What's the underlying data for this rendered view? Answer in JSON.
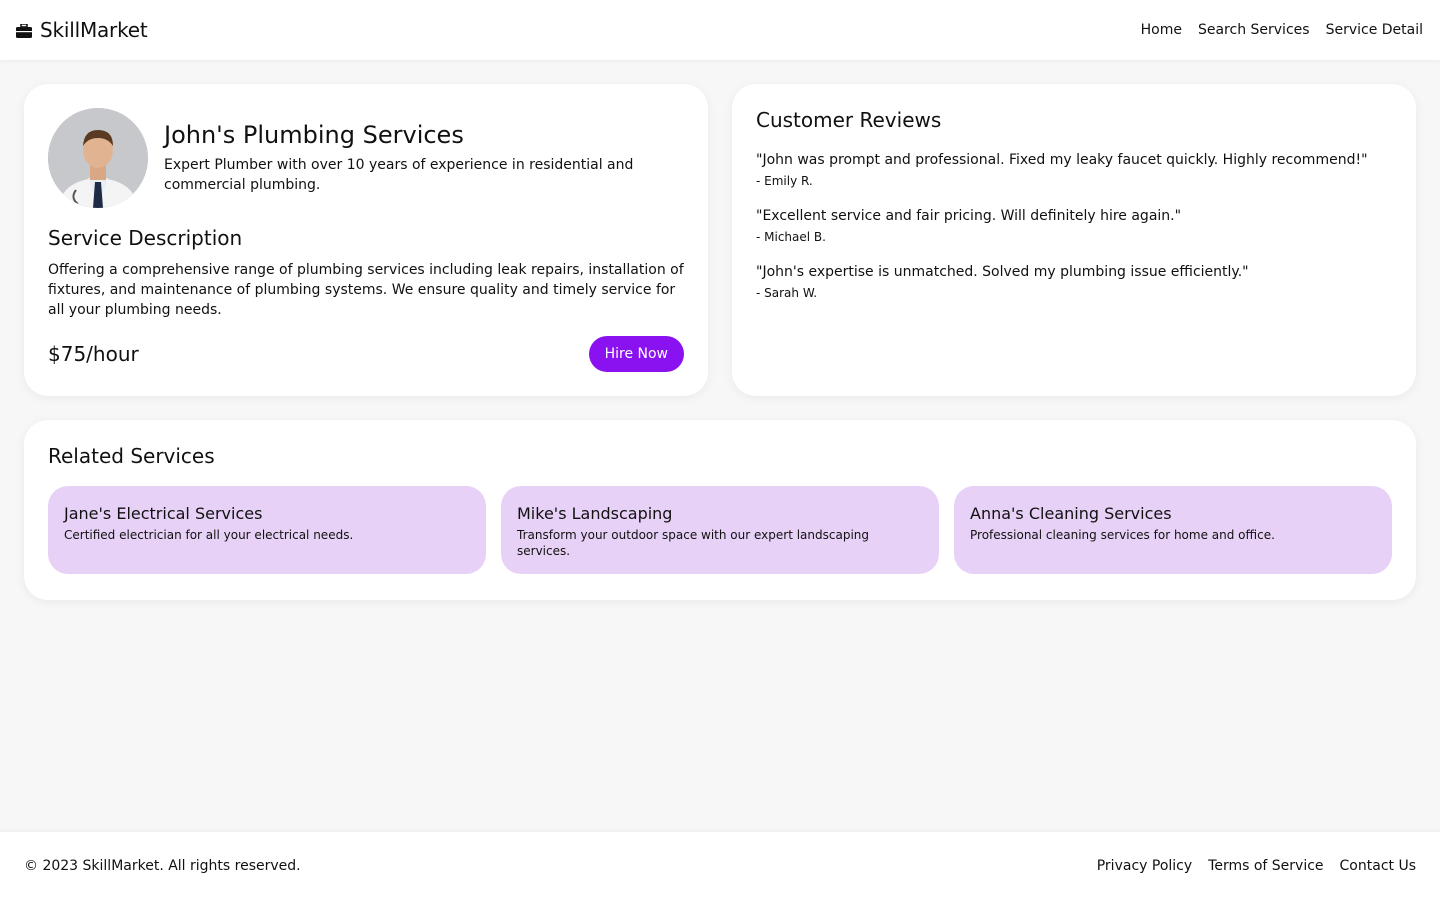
{
  "header": {
    "brand_icon": "briefcase-icon",
    "brand": "SkillMarket",
    "nav": [
      "Home",
      "Search Services",
      "Service Detail"
    ]
  },
  "provider": {
    "avatar_icon": "provider-avatar",
    "name": "John's Plumbing Services",
    "tagline": "Expert Plumber with over 10 years of experience in residential and commercial plumbing.",
    "description_title": "Service Description",
    "description": "Offering a comprehensive range of plumbing services including leak repairs, installation of fixtures, and maintenance of plumbing systems. We ensure quality and timely service for all your plumbing needs.",
    "price": "$75/hour",
    "hire_label": "Hire Now"
  },
  "reviews": {
    "title": "Customer Reviews",
    "items": [
      {
        "text": "\"John was prompt and professional. Fixed my leaky faucet quickly. Highly recommend!\"",
        "author": "- Emily R."
      },
      {
        "text": "\"Excellent service and fair pricing. Will definitely hire again.\"",
        "author": "- Michael B."
      },
      {
        "text": "\"John's expertise is unmatched. Solved my plumbing issue efficiently.\"",
        "author": "- Sarah W."
      }
    ]
  },
  "related": {
    "title": "Related Services",
    "items": [
      {
        "name": "Jane's Electrical Services",
        "desc": "Certified electrician for all your electrical needs."
      },
      {
        "name": "Mike's Landscaping",
        "desc": "Transform your outdoor space with our expert landscaping services."
      },
      {
        "name": "Anna's Cleaning Services",
        "desc": "Professional cleaning services for home and office."
      }
    ]
  },
  "footer": {
    "copyright": "© 2023 SkillMarket. All rights reserved.",
    "links": [
      "Privacy Policy",
      "Terms of Service",
      "Contact Us"
    ]
  },
  "colors": {
    "accent": "#8b12f0",
    "related_card_bg": "#e8d1f7",
    "page_bg": "#f7f7f8"
  }
}
